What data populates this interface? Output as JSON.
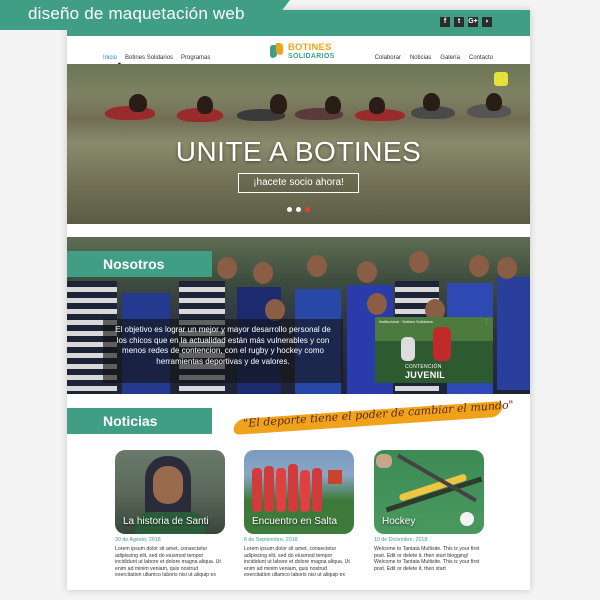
{
  "banner": {
    "text": "diseño de maquetación web"
  },
  "social": [
    "f",
    "t",
    "G+",
    "rss"
  ],
  "nav": {
    "left": [
      "Inicio",
      "Botines Solidarios",
      "Programas"
    ],
    "right": [
      "Colaborar",
      "Noticias",
      "Galería",
      "Contacto"
    ]
  },
  "logo": {
    "line1": "BOTINES",
    "line2": "SOLIDARIOS"
  },
  "hero": {
    "title": "UNITE A BOTINES",
    "cta": "¡hacete socio ahora!"
  },
  "nosotros": {
    "title": "Nosotros",
    "text": "El objetivo es lograr un mejor y mayor desarrollo personal de los chicos que en la actualidad están más vulnerables y con menos redes de contencion, con el rugby y hockey como herramientas deportivas y de valores.",
    "video": {
      "top_text": "Institucional · Botines Solidarios",
      "caption1": "CONTENCIÓN",
      "caption2": "JUVENIL"
    }
  },
  "noticias": {
    "title": "Noticias",
    "quote": "\"El deporte tiene el poder de cambiar el mundo\"",
    "cards": [
      {
        "title": "La historia de Santi",
        "date": "30 de Agosto, 2018",
        "body": "Lorem ipsum dolor sit amet, consectetur adipiscing elit, sed do eiusmod tempor incididunt ut labore et dolore magna aliqua. Ut enim ad minim veniam, quis nostrud exercitation ullamco laboris nisi ut aliquip ex"
      },
      {
        "title": "Encuentro en Salta",
        "date": "6 de Septiembre, 2018",
        "body": "Lorem ipsum dolor sit amet, consectetur adipiscing elit, sed do eiusmod tempor incididunt ut labore et dolore magna aliqua. Ut enim ad minim veniam, quis nostrud exercitation ullamco laboris nisi ut aliquip ex"
      },
      {
        "title": "Hockey",
        "date": "10 de Diciembre, 2018",
        "body": "Welcome to Tantata Multisite. This is your first post. Edit or delete it, then start blogging! Welcome to Tantata Multisite. This is your first post. Edit or delete it, then start"
      }
    ]
  },
  "colors": {
    "green": "#3f9e83",
    "orange": "#f0a31a",
    "active_link": "#3d78c5",
    "slider_active": "#e0402e"
  }
}
